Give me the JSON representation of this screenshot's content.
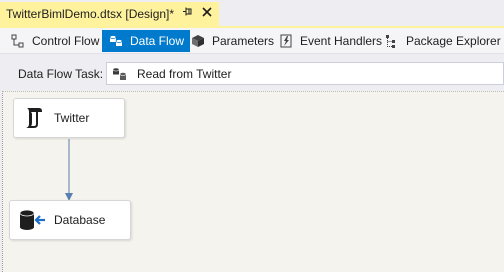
{
  "document_tab": {
    "title": "TwitterBimlDemo.dtsx [Design]*",
    "pin_icon": "pin-icon",
    "close_icon": "close-icon"
  },
  "designer_tabs": [
    {
      "label": "Control Flow",
      "icon": "control-flow-icon",
      "active": false
    },
    {
      "label": "Data Flow",
      "icon": "data-flow-icon",
      "active": true
    },
    {
      "label": "Parameters",
      "icon": "parameters-icon",
      "active": false
    },
    {
      "label": "Event Handlers",
      "icon": "event-handlers-icon",
      "active": false
    },
    {
      "label": "Package Explorer",
      "icon": "package-explorer-icon",
      "active": false
    }
  ],
  "task_selector": {
    "label": "Data Flow Task:",
    "value": "Read from Twitter",
    "icon": "data-flow-task-icon"
  },
  "canvas": {
    "components": [
      {
        "name": "Twitter",
        "icon": "script-component-icon"
      },
      {
        "name": "Database",
        "icon": "destination-icon"
      }
    ],
    "connector": {
      "from": "Twitter",
      "to": "Database"
    }
  },
  "colors": {
    "active_tab": "#007acc",
    "document_tab": "#fff29d",
    "canvas": "#f5f3ee",
    "connector": "#5b7fae"
  }
}
